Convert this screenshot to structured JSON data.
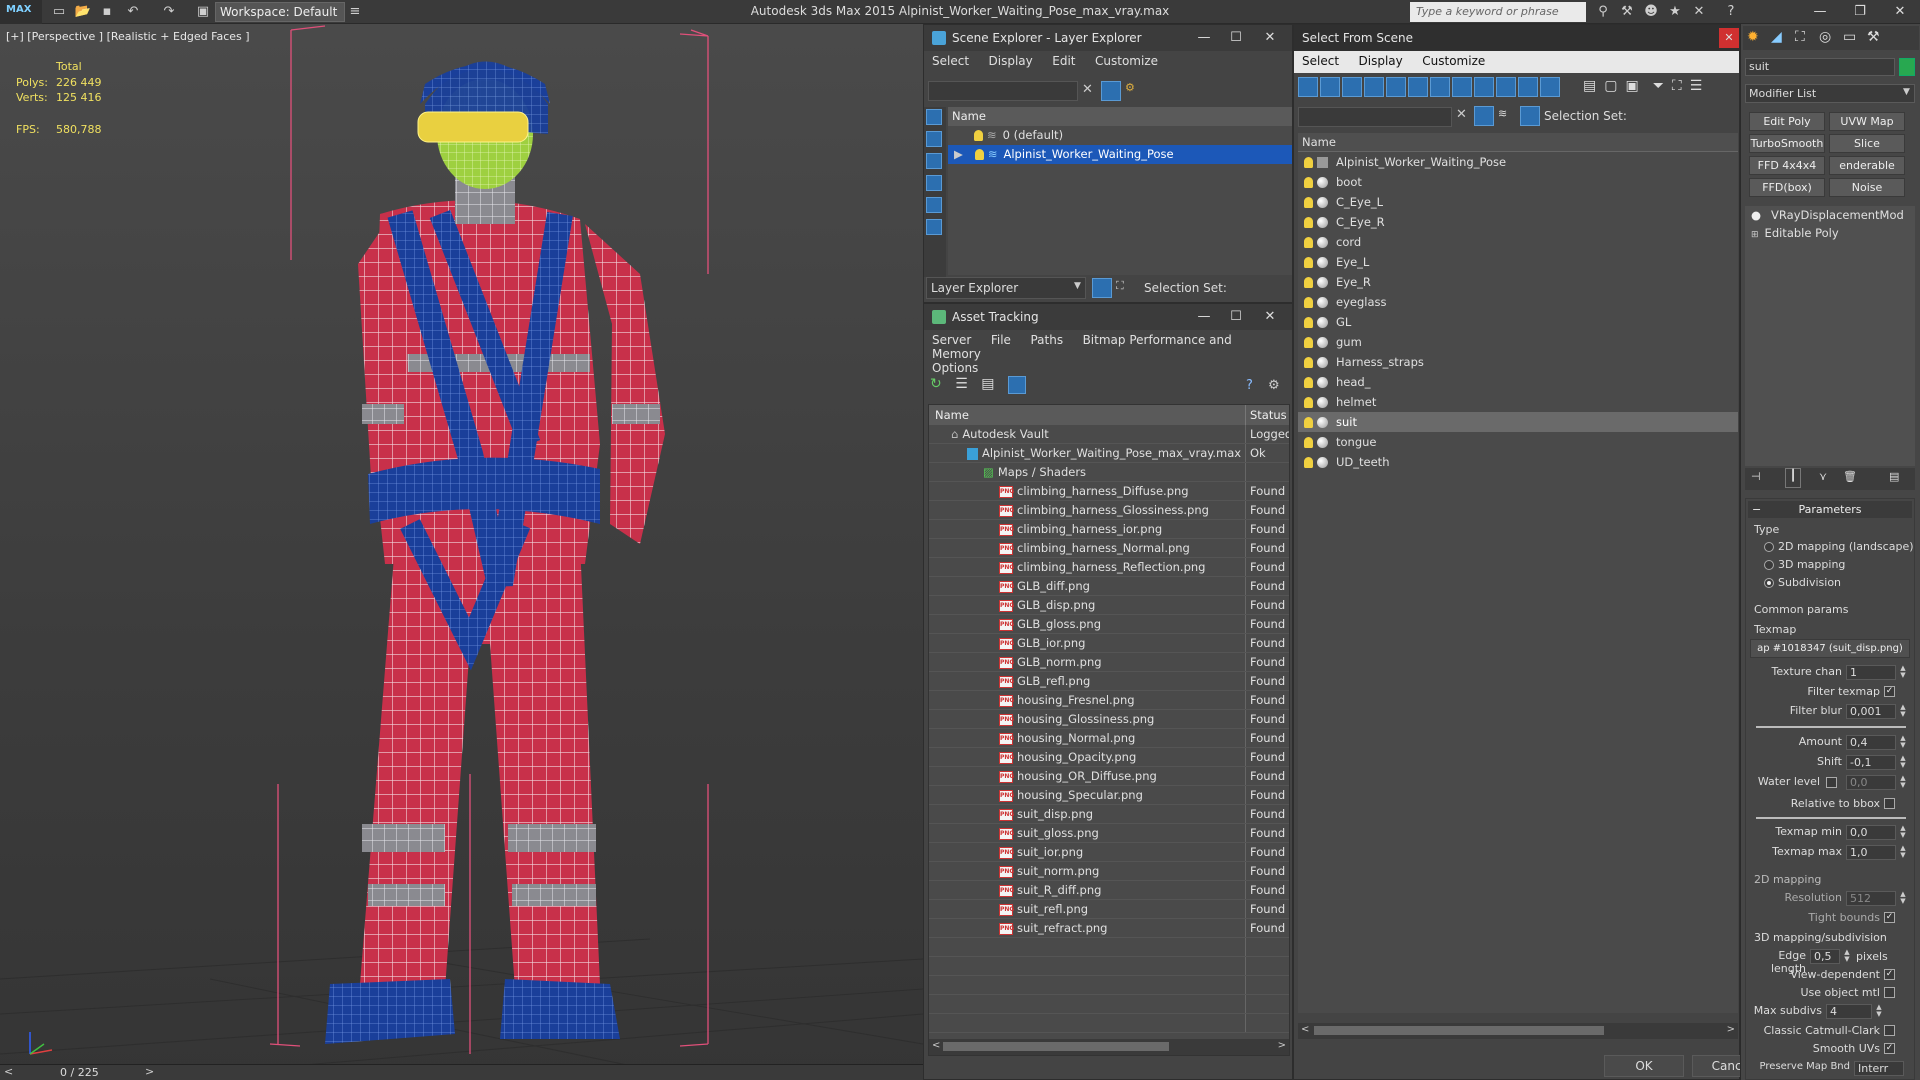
{
  "app": {
    "logo": "MAX",
    "workspace": "Workspace: Default",
    "title": "Autodesk 3ds Max  2015     Alpinist_Worker_Waiting_Pose_max_vray.max",
    "search_placeholder": "Type a keyword or phrase"
  },
  "viewport": {
    "label": "[+] [Perspective ] [Realistic + Edged Faces ]",
    "stats": {
      "total_label": "Total",
      "polys_label": "Polys:",
      "polys_value": "226 449",
      "verts_label": "Verts:",
      "verts_value": "125 416",
      "fps_label": "FPS:",
      "fps_value": "580,788"
    },
    "timeline": "0 / 225"
  },
  "scene_explorer": {
    "title": "Scene Explorer - Layer Explorer",
    "menu": [
      "Select",
      "Display",
      "Edit",
      "Customize"
    ],
    "column": "Name",
    "layers": [
      "0 (default)",
      "Alpinist_Worker_Waiting_Pose"
    ],
    "footer_dropdown": "Layer Explorer",
    "selection_set_label": "Selection Set:"
  },
  "asset_tracking": {
    "title": "Asset Tracking",
    "menu": [
      "Server",
      "File",
      "Paths",
      "Bitmap Performance and Memory",
      "Options"
    ],
    "columns": {
      "name": "Name",
      "status": "Status"
    },
    "vault": {
      "name": "Autodesk Vault",
      "status": "Logged"
    },
    "file": {
      "name": "Alpinist_Worker_Waiting_Pose_max_vray.max",
      "status": "Ok"
    },
    "group": "Maps / Shaders",
    "items": [
      {
        "name": "climbing_harness_Diffuse.png",
        "status": "Found"
      },
      {
        "name": "climbing_harness_Glossiness.png",
        "status": "Found"
      },
      {
        "name": "climbing_harness_ior.png",
        "status": "Found"
      },
      {
        "name": "climbing_harness_Normal.png",
        "status": "Found"
      },
      {
        "name": "climbing_harness_Reflection.png",
        "status": "Found"
      },
      {
        "name": "GLB_diff.png",
        "status": "Found"
      },
      {
        "name": "GLB_disp.png",
        "status": "Found"
      },
      {
        "name": "GLB_gloss.png",
        "status": "Found"
      },
      {
        "name": "GLB_ior.png",
        "status": "Found"
      },
      {
        "name": "GLB_norm.png",
        "status": "Found"
      },
      {
        "name": "GLB_refl.png",
        "status": "Found"
      },
      {
        "name": "housing_Fresnel.png",
        "status": "Found"
      },
      {
        "name": "housing_Glossiness.png",
        "status": "Found"
      },
      {
        "name": "housing_Normal.png",
        "status": "Found"
      },
      {
        "name": "housing_Opacity.png",
        "status": "Found"
      },
      {
        "name": "housing_OR_Diffuse.png",
        "status": "Found"
      },
      {
        "name": "housing_Specular.png",
        "status": "Found"
      },
      {
        "name": "suit_disp.png",
        "status": "Found"
      },
      {
        "name": "suit_gloss.png",
        "status": "Found"
      },
      {
        "name": "suit_ior.png",
        "status": "Found"
      },
      {
        "name": "suit_norm.png",
        "status": "Found"
      },
      {
        "name": "suit_R_diff.png",
        "status": "Found"
      },
      {
        "name": "suit_refl.png",
        "status": "Found"
      },
      {
        "name": "suit_refract.png",
        "status": "Found"
      }
    ]
  },
  "select_from_scene": {
    "title": "Select From Scene",
    "menu": [
      "Select",
      "Display",
      "Customize"
    ],
    "selection_set_label": "Selection Set:",
    "column": "Name",
    "objects": [
      "Alpinist_Worker_Waiting_Pose",
      "boot",
      "C_Eye_L",
      "C_Eye_R",
      "cord",
      "Eye_L",
      "Eye_R",
      "eyeglass",
      "GL",
      "gum",
      "Harness_straps",
      "head_",
      "helmet",
      "suit",
      "tongue",
      "UD_teeth"
    ],
    "selected": "suit",
    "ok": "OK",
    "cancel": "Cancel"
  },
  "command_panel": {
    "object_name": "suit",
    "modifier_list": "Modifier List",
    "buttons": [
      "Edit Poly",
      "UVW Map",
      "TurboSmooth",
      "Slice",
      "FFD 4x4x4",
      "enderable Splin",
      "FFD(box)",
      "Noise"
    ],
    "stack": [
      "VRayDisplacementMod",
      "Editable Poly"
    ],
    "parameters": {
      "title": "Parameters",
      "type_label": "Type",
      "types": [
        "2D mapping (landscape)",
        "3D mapping",
        "Subdivision"
      ],
      "common_params": "Common params",
      "texmap_label": "Texmap",
      "texmap_value": "ap #1018347 (suit_disp.png)",
      "texture_chan_label": "Texture chan",
      "texture_chan": "1",
      "filter_texmap": "Filter texmap",
      "filter_blur_label": "Filter blur",
      "filter_blur": "0,001",
      "amount_label": "Amount",
      "amount": "0,4",
      "shift_label": "Shift",
      "shift": "-0,1",
      "water_level_label": "Water level",
      "water_level": "0,0",
      "relative_bbox": "Relative to bbox",
      "texmap_min_label": "Texmap min",
      "texmap_min": "0,0",
      "texmap_max_label": "Texmap max",
      "texmap_max": "1,0",
      "mapping2d": "2D mapping",
      "resolution_label": "Resolution",
      "resolution": "512",
      "tight_bounds": "Tight bounds",
      "mapping3d": "3D mapping/subdivision",
      "edge_length_label": "Edge length",
      "edge_length": "0,5",
      "pixels": "pixels",
      "view_dependent": "View-dependent",
      "use_object_mtl": "Use object mtl",
      "max_subdivs_label": "Max subdivs",
      "max_subdivs": "4",
      "classic_catmull": "Classic Catmull-Clark",
      "smooth_uvs": "Smooth UVs",
      "preserve_map_bnd": "Preserve Map Bnd",
      "preserve_value": "Interr"
    }
  }
}
